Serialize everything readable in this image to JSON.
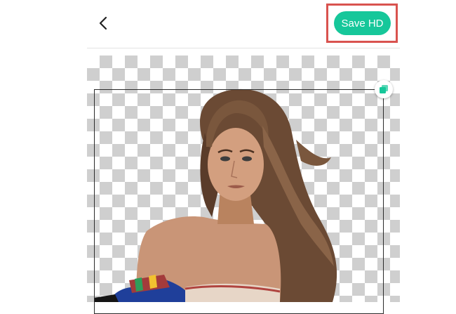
{
  "header": {
    "back_icon": "chevron-left-icon",
    "save_label": "Save HD",
    "save_color": "#16c79a",
    "save_text_color": "#ffffff",
    "highlight_color": "#d9534f"
  },
  "editor": {
    "background": "transparent-checkerboard",
    "checker_color": "#cfcfcf",
    "frame_color": "#2b2b2b",
    "handle_icon": "layers-icon",
    "handle_color": "#16c79a",
    "subject_image": "cutout-portrait-woman-long-hair"
  }
}
